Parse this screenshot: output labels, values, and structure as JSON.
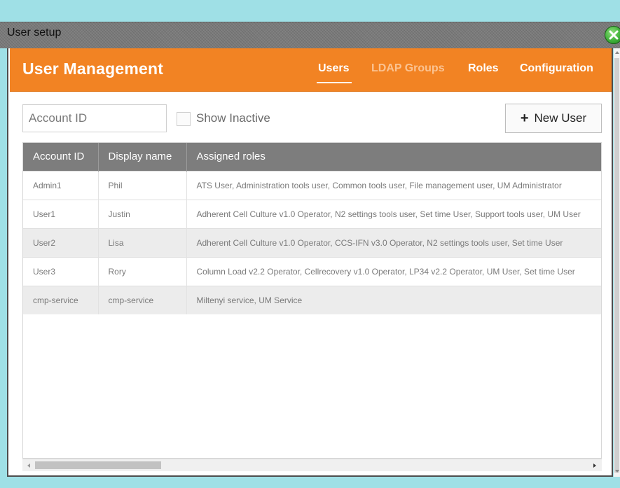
{
  "window": {
    "title": "User setup"
  },
  "header": {
    "title": "User Management",
    "tabs": [
      {
        "label": "Users",
        "active": true
      },
      {
        "label": "LDAP Groups",
        "active": false
      },
      {
        "label": "Roles",
        "active": true
      },
      {
        "label": "Configuration",
        "active": true
      }
    ],
    "color": "#f28323"
  },
  "toolbar": {
    "account_placeholder": "Account ID",
    "show_inactive_label": "Show Inactive",
    "show_inactive_checked": false,
    "new_user_label": "New User"
  },
  "table": {
    "columns": [
      "Account ID",
      "Display name",
      "Assigned roles"
    ],
    "rows": [
      {
        "account": "Admin1",
        "display": "Phil",
        "roles": "ATS User, Administration tools user, Common tools user, File management user, UM Administrator"
      },
      {
        "account": "User1",
        "display": "Justin",
        "roles": "Adherent Cell Culture v1.0 Operator, N2 settings tools user, Set time User, Support tools user, UM User"
      },
      {
        "account": "User2",
        "display": "Lisa",
        "roles": "Adherent Cell Culture v1.0 Operator, CCS-IFN v3.0 Operator, N2 settings tools user, Set time User"
      },
      {
        "account": "User3",
        "display": "Rory",
        "roles": "Column Load v2.2 Operator, Cellrecovery v1.0 Operator, LP34 v2.2 Operator, UM User, Set time User"
      },
      {
        "account": "cmp-service",
        "display": "cmp-service",
        "roles": "Miltenyi service, UM Service"
      }
    ]
  }
}
